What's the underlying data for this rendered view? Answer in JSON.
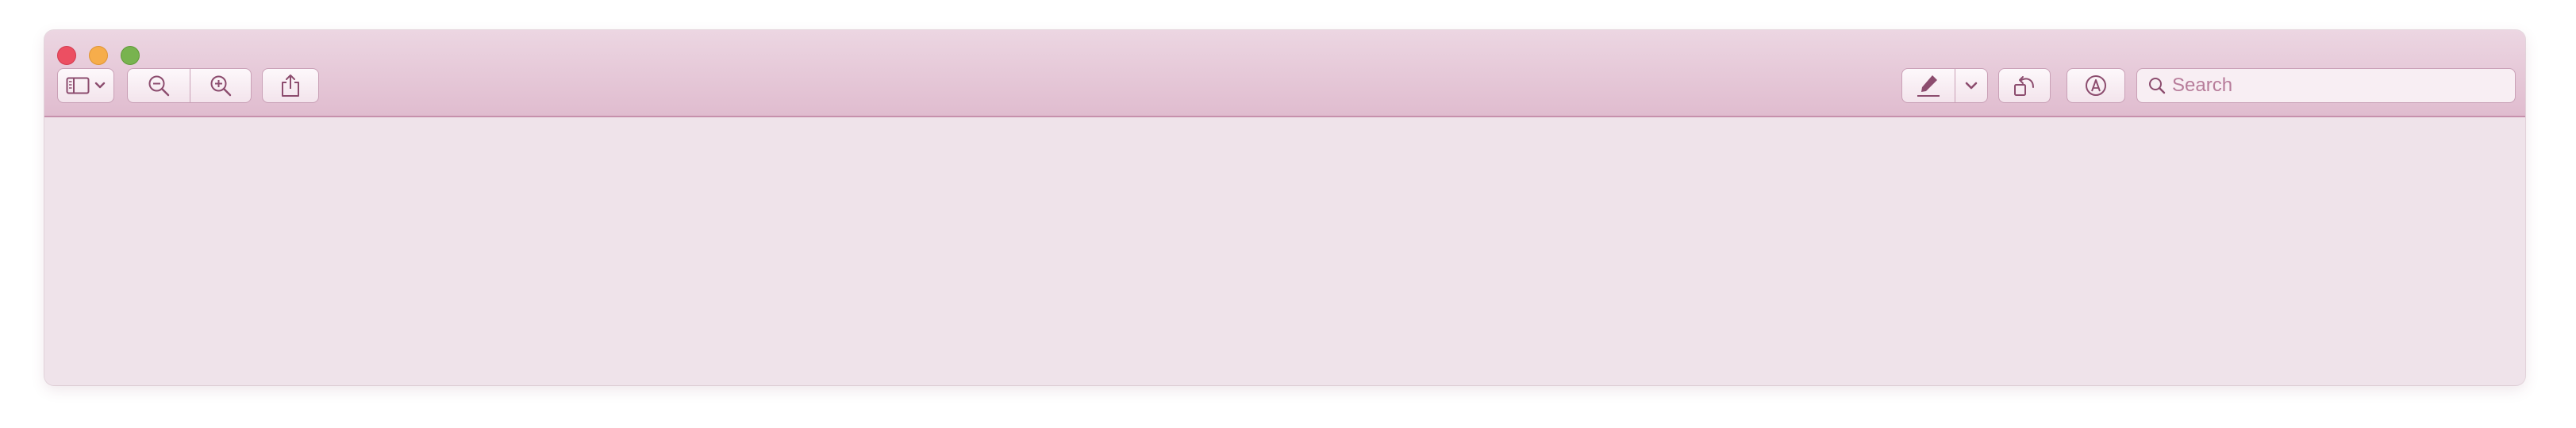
{
  "window": {
    "title": ""
  },
  "toolbar": {
    "sidebar_button": {
      "icon": "sidebar-icon",
      "menu_icon": "chevron-down-icon"
    },
    "zoom_out": {
      "icon": "zoom-out-icon"
    },
    "zoom_in": {
      "icon": "zoom-in-icon"
    },
    "share": {
      "icon": "share-icon"
    },
    "markup": {
      "icon": "pen-icon",
      "menu_icon": "chevron-down-icon"
    },
    "rotate": {
      "icon": "rotate-left-icon"
    },
    "annotate": {
      "icon": "markup-circle-icon"
    }
  },
  "search": {
    "placeholder": "Search",
    "value": ""
  },
  "colors": {
    "titlebar": "#e0bccf",
    "content": "#efe3ea",
    "accent": "#8c4c6e",
    "close": "#ec4f62",
    "minimize": "#f6ad4b",
    "zoom": "#78b34f"
  }
}
